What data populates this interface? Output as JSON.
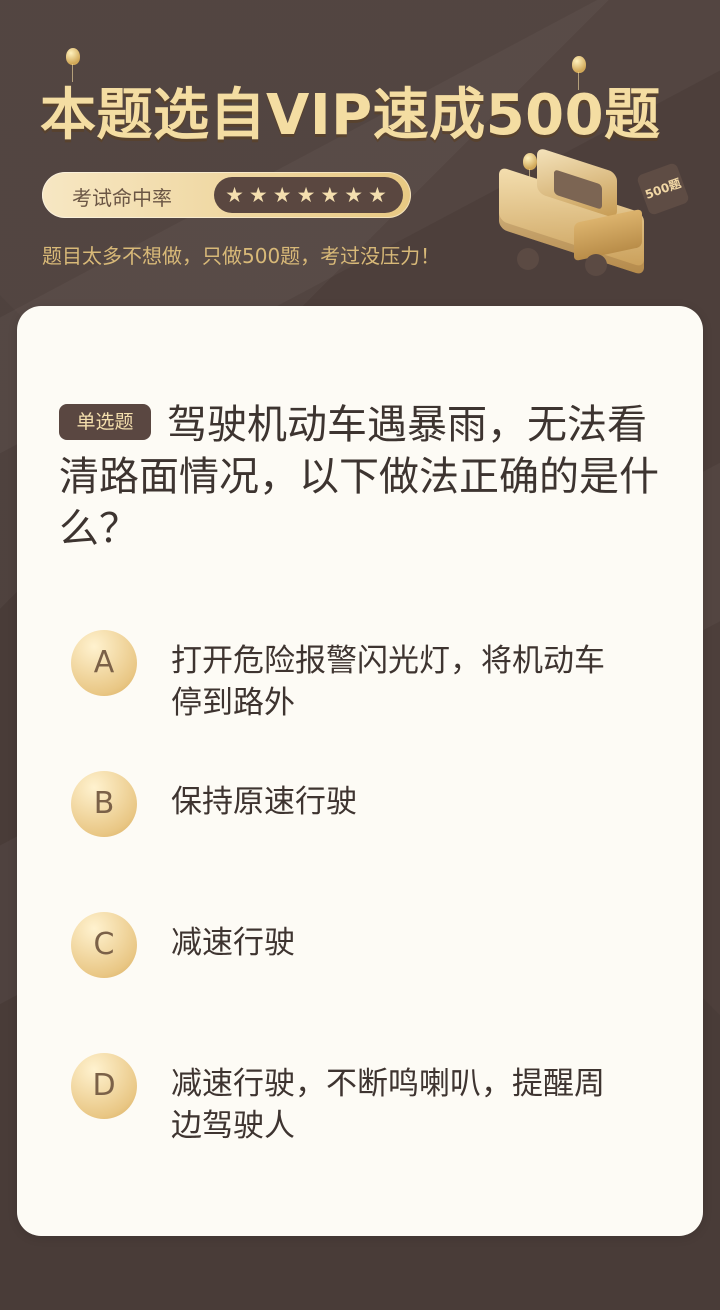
{
  "header": {
    "title": "本题选自VIP速成500题",
    "rate_label": "考试命中率",
    "stars": "★★★★★★★",
    "subtitle": "题目太多不想做，只做500题，考过没压力！",
    "badge_text": "500题"
  },
  "question": {
    "type_label": "单选题",
    "text": "驾驶机动车遇暴雨，无法看清路面情况，以下做法正确的是什么？"
  },
  "options": [
    {
      "letter": "A",
      "text": "打开危险报警闪光灯，将机动车停到路外"
    },
    {
      "letter": "B",
      "text": "保持原速行驶"
    },
    {
      "letter": "C",
      "text": "减速行驶"
    },
    {
      "letter": "D",
      "text": "减速行驶，不断鸣喇叭，提醒周边驾驶人"
    }
  ],
  "colors": {
    "background": "#4d3f3b",
    "title_gold": "#f4dda2",
    "card": "#fdfbf5",
    "badge_dark": "#5a4741",
    "option_gold": "#e9c785"
  }
}
